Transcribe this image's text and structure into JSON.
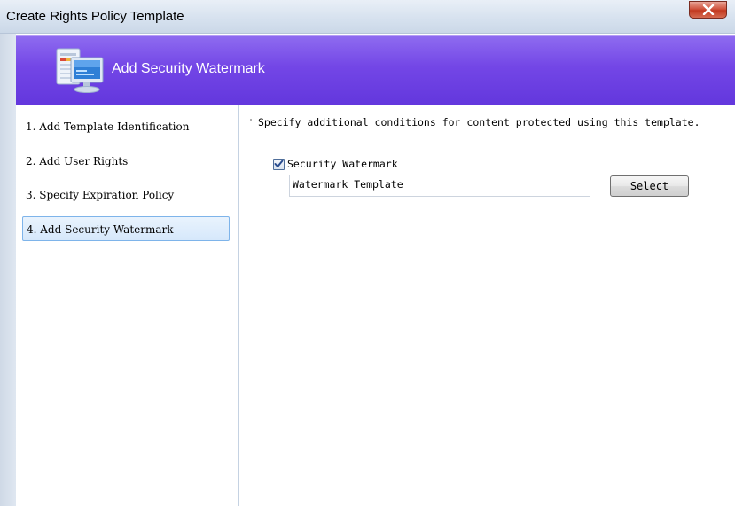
{
  "window": {
    "title": "Create Rights Policy Template"
  },
  "header": {
    "title": "Add Security Watermark",
    "icon": "computer-monitor-icon"
  },
  "nav": {
    "items": [
      {
        "label": "1. Add Template Identification",
        "active": false
      },
      {
        "label": "2. Add User Rights",
        "active": false
      },
      {
        "label": "3. Specify Expiration Policy",
        "active": false
      },
      {
        "label": "4. Add Security Watermark",
        "active": true
      }
    ]
  },
  "content": {
    "description": "Specify additional conditions for content protected using this template.",
    "watermark_checkbox": {
      "label": "Security Watermark",
      "checked": true
    },
    "watermark_field": {
      "value": "Watermark Template"
    },
    "select_button": "Select"
  },
  "colors": {
    "banner": "#7346e6",
    "selection_border": "#7eb4ea",
    "close_button": "#c2391f"
  }
}
